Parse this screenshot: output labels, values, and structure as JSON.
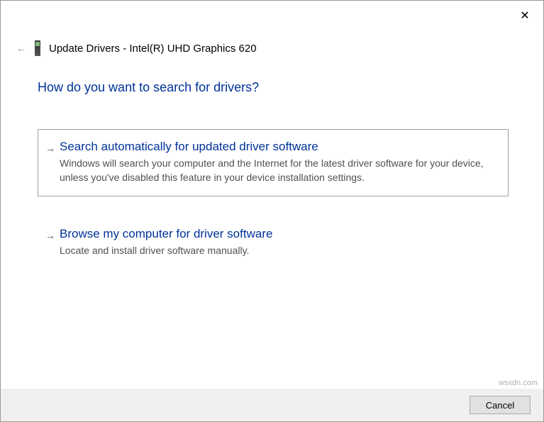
{
  "header": {
    "title": "Update Drivers - Intel(R) UHD Graphics 620"
  },
  "question": "How do you want to search for drivers?",
  "options": [
    {
      "title": "Search automatically for updated driver software",
      "desc": "Windows will search your computer and the Internet for the latest driver software for your device, unless you've disabled this feature in your device installation settings."
    },
    {
      "title": "Browse my computer for driver software",
      "desc": "Locate and install driver software manually."
    }
  ],
  "footer": {
    "cancel": "Cancel"
  },
  "watermark": "wsxdn.com"
}
